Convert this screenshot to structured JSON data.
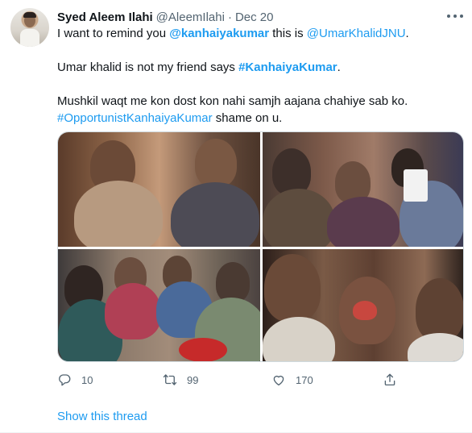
{
  "author": {
    "name": "Syed Aleem Ilahi",
    "handle": "@AleemIlahi",
    "separator": "·",
    "date": "Dec 20"
  },
  "icons": {
    "more": "more-horizontal-icon",
    "reply": "reply-icon",
    "retweet": "retweet-icon",
    "like": "like-icon",
    "share": "share-icon"
  },
  "tweet": {
    "line1_prefix": "I want to remind you ",
    "line1_mention1": "@kanhaiyakumar",
    "line1_mid": " this is ",
    "line1_mention2": "@UmarKhalidJNU",
    "line1_suffix": ".",
    "line2_prefix": "Umar khalid is not my friend says ",
    "line2_hashtag": "#KanhaiyaKumar",
    "line2_suffix": ".",
    "line3": "Mushkil waqt me kon dost kon nahi samjh aajana chahiye sab ko.",
    "line4_hashtag": "#OpportunistKanhaiyaKumar",
    "line4_suffix": " shame on u."
  },
  "stats": {
    "replies": "10",
    "retweets": "99",
    "likes": "170"
  },
  "show_thread": "Show this thread",
  "colors": {
    "link": "#1d9bf0",
    "text": "#0f1419",
    "secondary": "#536471",
    "border": "#cfd9de"
  }
}
